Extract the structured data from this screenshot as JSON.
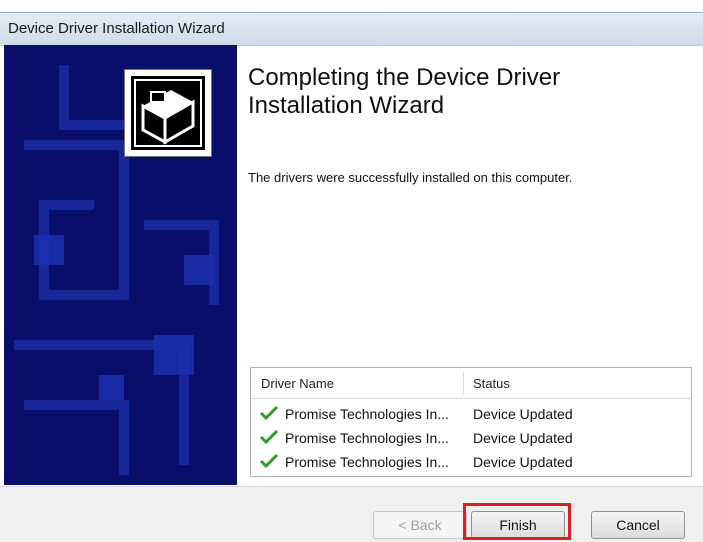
{
  "window": {
    "title": "Device Driver Installation Wizard"
  },
  "colors": {
    "left_panel": "#0a0e6b",
    "check": "#2e9a2e",
    "highlight": "#d9202a"
  },
  "heading": {
    "line1": "Completing the Device Driver",
    "line2": "Installation Wizard"
  },
  "message": "The drivers were successfully installed on this computer.",
  "table": {
    "columns": [
      "Driver Name",
      "Status"
    ],
    "rows": [
      {
        "name": "Promise Technologies In...",
        "status": "Device Updated",
        "icon": "green-check-icon"
      },
      {
        "name": "Promise Technologies In...",
        "status": "Device Updated",
        "icon": "green-check-icon"
      },
      {
        "name": "Promise Technologies In...",
        "status": "Device Updated",
        "icon": "green-check-icon"
      }
    ]
  },
  "buttons": {
    "back": "< Back",
    "finish": "Finish",
    "cancel": "Cancel"
  }
}
